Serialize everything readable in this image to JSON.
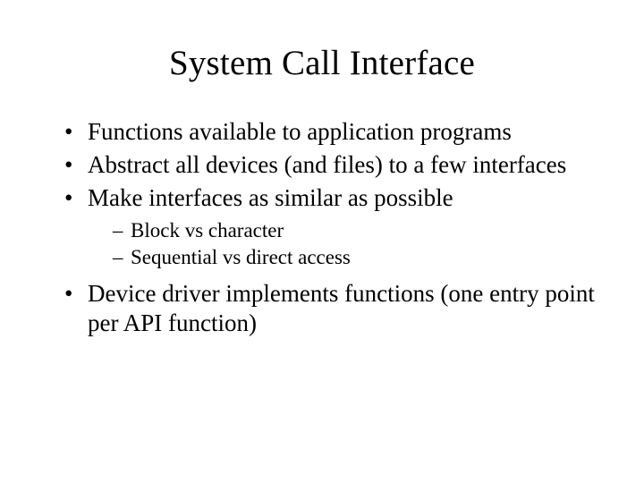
{
  "title": "System Call Interface",
  "bullets": {
    "b1": "Functions available to application programs",
    "b2": "Abstract all devices (and files) to a few interfaces",
    "b3": "Make interfaces as similar as possible",
    "b3_sub": {
      "s1": "Block vs character",
      "s2": "Sequential vs direct access"
    },
    "b4": "Device driver implements functions (one entry point per API function)"
  }
}
